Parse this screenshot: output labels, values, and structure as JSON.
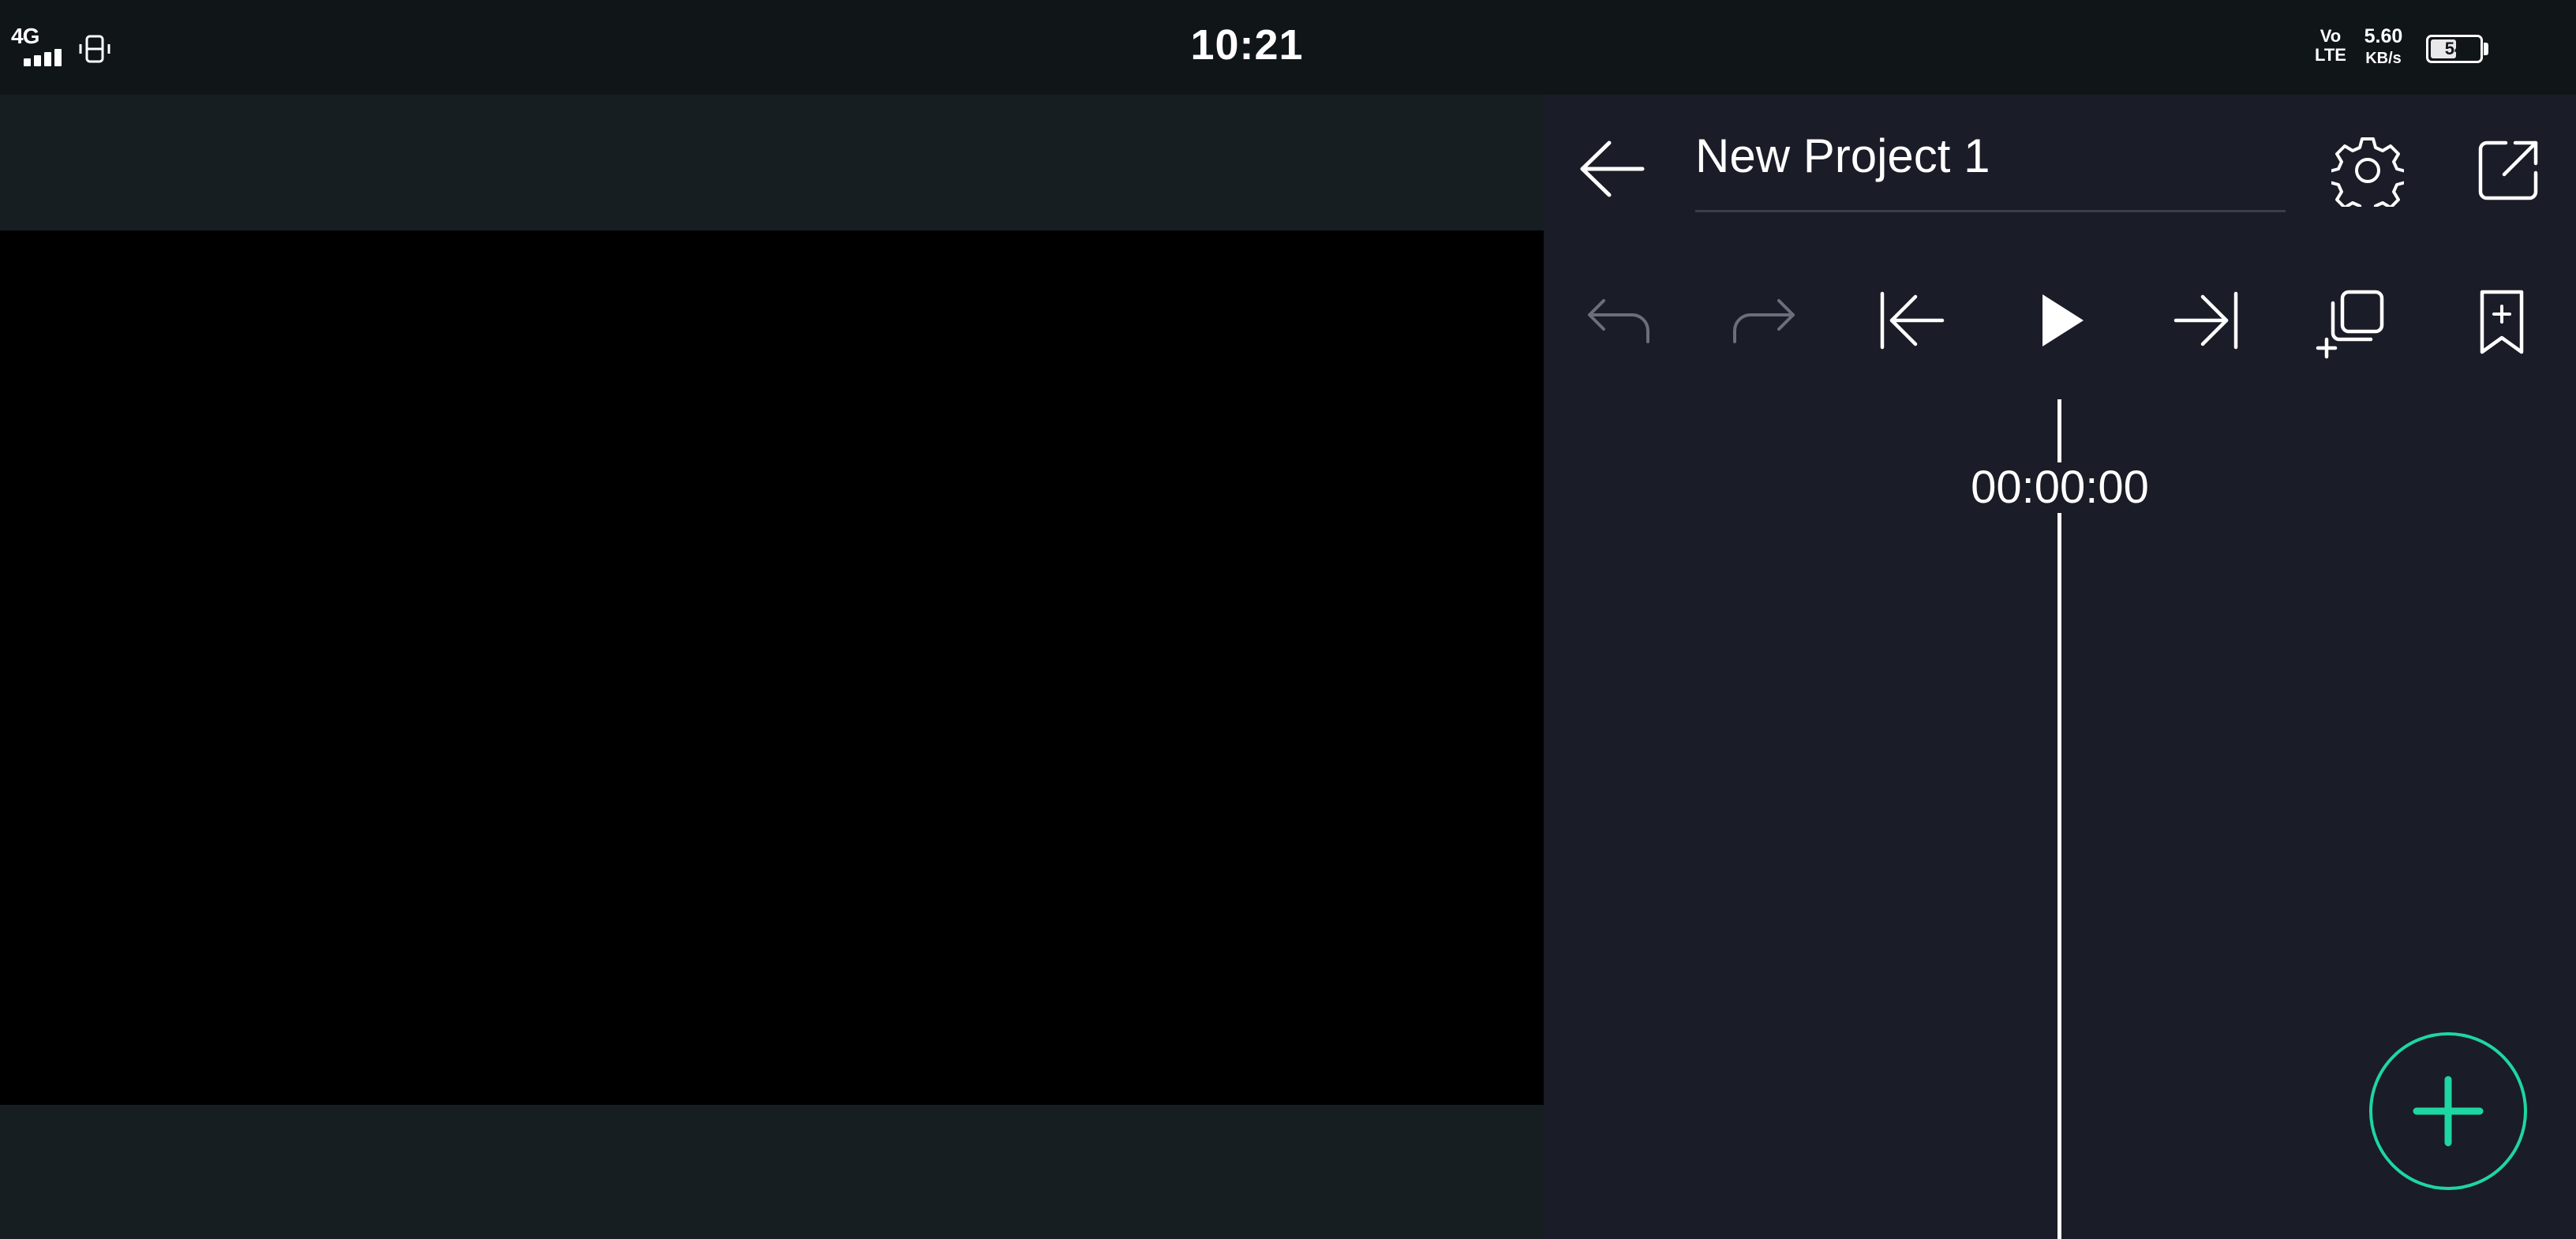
{
  "status_bar": {
    "network": "4G",
    "time": "10:21",
    "volte_top": "Vo",
    "volte_bottom": "LTE",
    "speed_value": "5.60",
    "speed_unit": "KB/s",
    "battery": "54",
    "battery_level_percent": 54
  },
  "header": {
    "project_name": "New Project 1"
  },
  "toolbar": {
    "undo_icon": "undo-icon",
    "redo_icon": "redo-icon",
    "skip_start_icon": "skip-to-start-icon",
    "play_icon": "play-icon",
    "skip_end_icon": "skip-to-end-icon",
    "duplicate_icon": "duplicate-layer-icon",
    "bookmark_icon": "add-bookmark-icon"
  },
  "timeline": {
    "timecode": "00:00:00"
  },
  "colors": {
    "accent": "#1ed6a1",
    "panel_bg": "#1a1c27",
    "preview_bg": "#000000",
    "disabled_icon": "#6b6f7b"
  }
}
